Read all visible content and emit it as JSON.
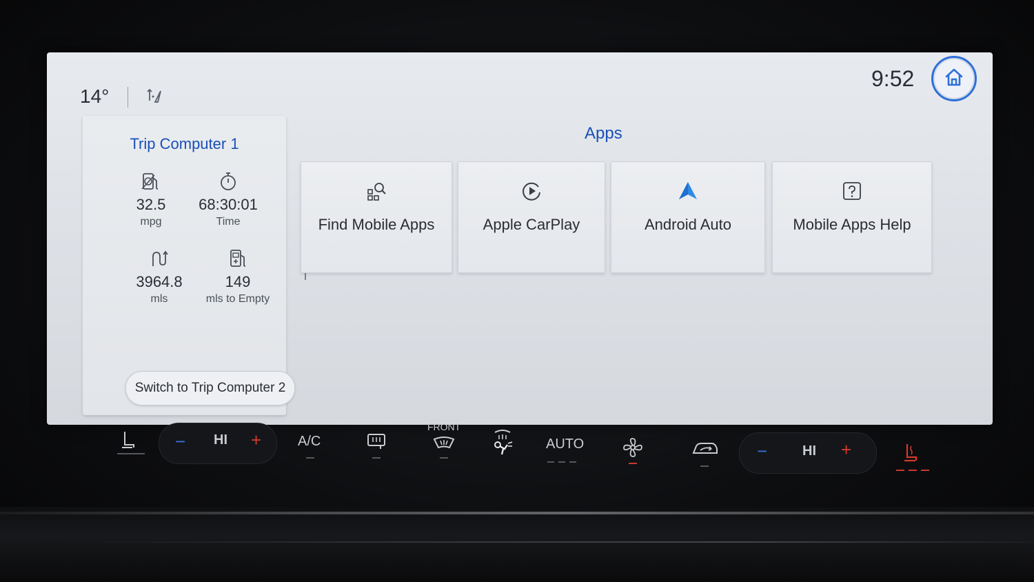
{
  "status_bar": {
    "temperature": "14°",
    "time": "9:52",
    "home_icon": "home-icon",
    "nav_icon": "navigation-arrows-icon"
  },
  "trip_computer": {
    "title": "Trip Computer 1",
    "metrics": [
      {
        "icon": "fuel-economy-icon",
        "value": "32.5",
        "label": "mpg"
      },
      {
        "icon": "stopwatch-icon",
        "value": "68:30:01",
        "label": "Time"
      },
      {
        "icon": "route-distance-icon",
        "value": "3964.8",
        "label": "mls"
      },
      {
        "icon": "fuel-pump-range-icon",
        "value": "149",
        "label": "mls to Empty"
      }
    ],
    "switch_label": "Switch to Trip Computer 2"
  },
  "apps": {
    "title": "Apps",
    "tiles": [
      {
        "icon": "find-apps-icon",
        "label": "Find Mobile Apps"
      },
      {
        "icon": "carplay-icon",
        "label": "Apple CarPlay"
      },
      {
        "icon": "android-auto-icon",
        "label": "Android Auto"
      },
      {
        "icon": "help-icon",
        "label": "Mobile Apps Help"
      }
    ]
  },
  "climate": {
    "left_temp_label": "HI",
    "ac_label": "A/C",
    "front_label": "FRONT",
    "auto_label": "AUTO",
    "right_temp_label": "HI",
    "minus": "−",
    "plus": "+",
    "colors": {
      "heat": "#d33a2c",
      "cool": "#3a6fd8",
      "accent": "#1a4fb5"
    }
  }
}
